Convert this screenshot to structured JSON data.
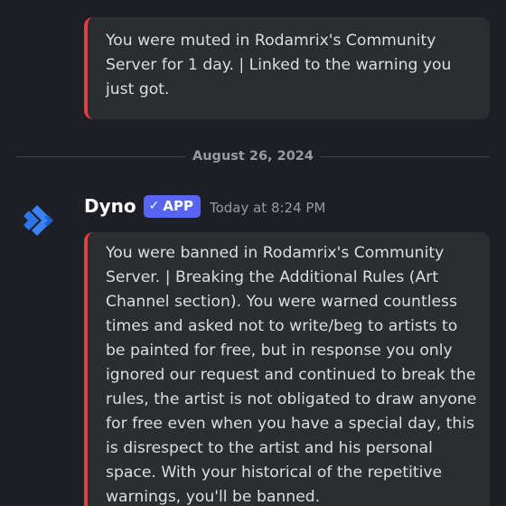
{
  "messages": [
    {
      "embed_text": "You were muted in Rodamrix's Community Server for 1 day. | Linked to the warning you just got."
    }
  ],
  "date_divider": {
    "label": "August 26, 2024"
  },
  "message": {
    "author": "Dyno",
    "badge_label": "APP",
    "badge_icon": "check-icon",
    "timestamp": "Today at 8:24 PM",
    "avatar_icon": "dyno-logo-icon",
    "embed_text": "You were banned in Rodamrix's Community Server. | Breaking the Additional Rules (Art Channel section). You were warned countless times and asked not to write/beg to artists to be painted for free, but in response you only ignored our request and continued to break the rules, the artist is not obligated to draw anyone for free even when you have a special day, this is disrespect to the artist and his personal space. With your historical of the repetitive warnings, you'll be banned."
  },
  "colors": {
    "background": "#1e1f24",
    "embed_background": "#2b2d31",
    "embed_accent": "#e04040",
    "badge": "#5865f2",
    "avatar_blue": "#2f73ea"
  }
}
